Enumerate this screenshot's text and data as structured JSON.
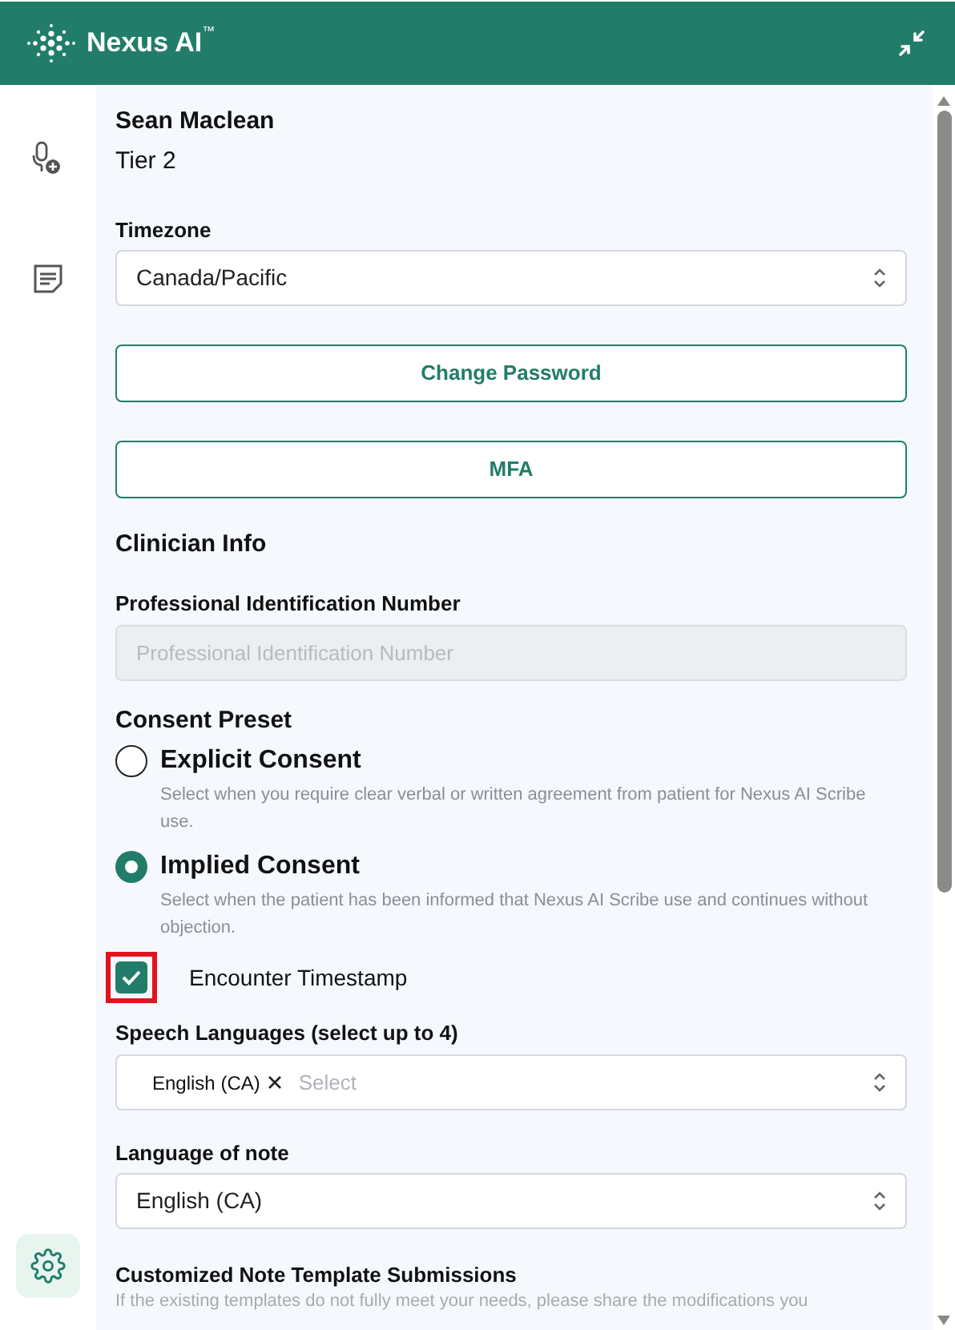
{
  "header": {
    "brand": "Nexus AI",
    "trademark": "™"
  },
  "sidebar": {
    "items": [
      {
        "kind": "mic",
        "selected": false
      },
      {
        "kind": "note",
        "selected": false
      },
      {
        "kind": "settings",
        "selected": true
      }
    ]
  },
  "profile": {
    "name": "Sean Maclean",
    "tier": "Tier 2"
  },
  "timezone": {
    "label": "Timezone",
    "value": "Canada/Pacific"
  },
  "buttons": [
    "Change Password",
    "MFA"
  ],
  "clinician_info": {
    "heading": "Clinician Info",
    "field_label": "Professional Identification Number",
    "placeholder": "Professional Identification Number"
  },
  "consent": {
    "heading": "Consent Preset",
    "options": [
      {
        "label": "Explicit Consent",
        "description": "Select when you require clear verbal or written agreement from patient for Nexus AI Scribe use.",
        "selected": false
      },
      {
        "label": "Implied Consent",
        "description": "Select when the patient has been informed that Nexus AI Scribe use and continues without objection.",
        "selected": true
      }
    ]
  },
  "encounter_timestamp": {
    "label": "Encounter Timestamp",
    "checked": true,
    "highlighted": true
  },
  "speech_languages": {
    "label": "Speech Languages (select up to 4)",
    "tags": [
      "English (CA)"
    ],
    "placeholder": "Select"
  },
  "note_language": {
    "label": "Language of note",
    "value": "English (CA)"
  },
  "templates": {
    "heading": "Customized Note Template Submissions",
    "description": "If the existing templates do not fully meet your needs, please share the modifications you"
  }
}
